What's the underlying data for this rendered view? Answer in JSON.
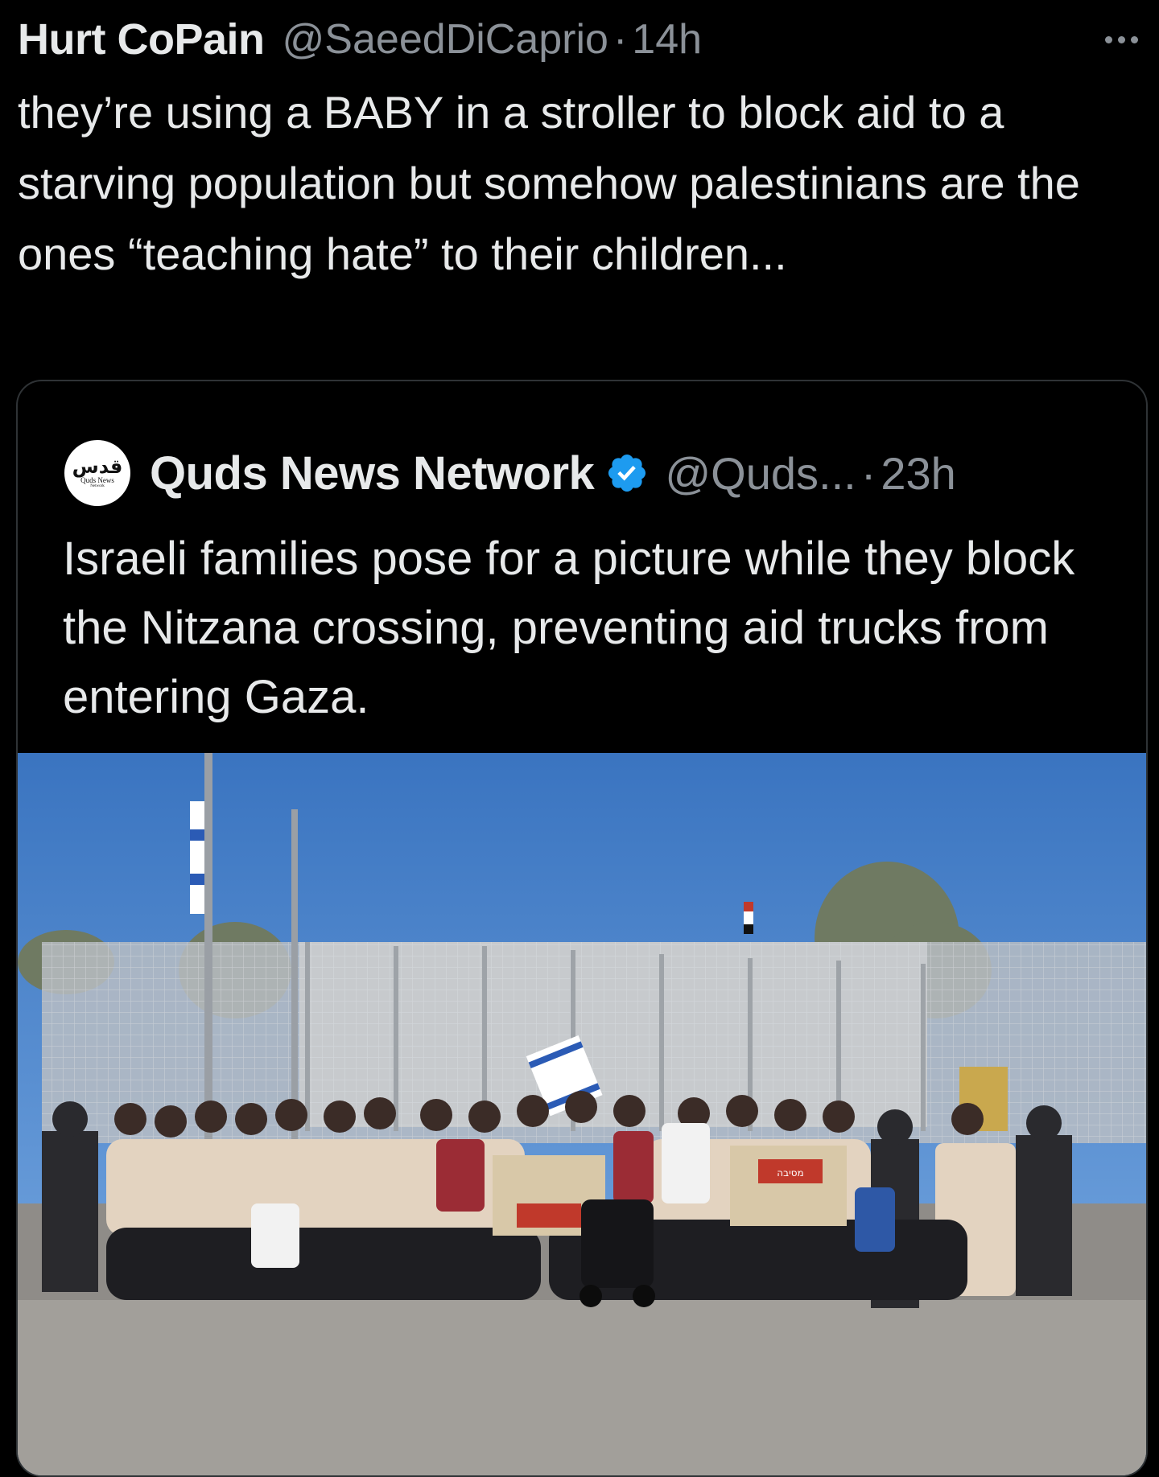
{
  "tweet": {
    "author_name": "Hurt CoPain",
    "author_handle": "@SaeedDiCaprio",
    "separator": "·",
    "timestamp": "14h",
    "text": "they’re using a BABY in a stroller to block aid to a starving population but somehow palestinians are the ones “teaching hate” to their children..."
  },
  "quoted_tweet": {
    "avatar": {
      "arabic_text": "قدس",
      "line1": "Quds News",
      "line2": "Network"
    },
    "author_name": "Quds News Network",
    "verified": true,
    "author_handle": "@Quds...",
    "separator": "·",
    "timestamp": "23h",
    "text": "Israeli families pose for a picture while they block the Nitzana crossing, preventing aid trucks from entering Gaza.",
    "photo": {
      "flag_text": "מסיבה",
      "sky_color": "#4a7fc4",
      "road_color": "#8f8c88"
    }
  },
  "colors": {
    "background": "#000000",
    "primary_text": "#e7e9ea",
    "secondary_text": "#8b9198",
    "border": "#2f3336",
    "verified_blue": "#1d9bf0"
  },
  "icons": {
    "more": "more-horizontal-icon",
    "verified": "verified-badge-icon"
  }
}
